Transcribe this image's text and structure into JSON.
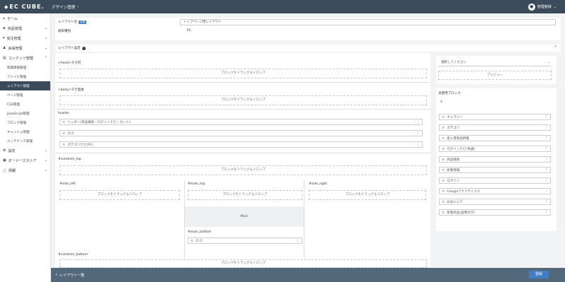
{
  "header": {
    "logo_mark": "◆",
    "logo_text": "EC CUBE.",
    "breadcrumb": "デザイン管理",
    "breadcrumb_icon": "chevron-right-icon",
    "user_name": "管理者様",
    "user_icon": "user-circle-icon"
  },
  "sidebar": {
    "items": [
      {
        "label": "ホーム",
        "icon": "home-icon"
      },
      {
        "label": "商品管理",
        "icon": "tag-icon"
      },
      {
        "label": "受注管理",
        "icon": "cart-icon"
      },
      {
        "label": "会員管理",
        "icon": "users-icon"
      },
      {
        "label": "コンテンツ管理",
        "icon": "document-icon"
      }
    ],
    "sub_items": [
      "新着情報管理",
      "ファイル管理",
      "レイアウト管理",
      "ページ管理",
      "CSS管理",
      "JavaScript管理",
      "ブロック管理",
      "キャッシュ管理",
      "メンテナンス管理"
    ],
    "bottom_items": [
      {
        "label": "設定",
        "icon": "gear-icon"
      },
      {
        "label": "オーナーズストア",
        "icon": "store-icon"
      },
      {
        "label": "情報",
        "icon": "info-icon"
      }
    ]
  },
  "settings": {
    "layout_name_label": "レイアウト名",
    "required_badge": "必須",
    "layout_name_value": "トップページ用レイアウト",
    "device_label": "端末種別",
    "device_value": "PC"
  },
  "layout_section": {
    "title": "レイアウト設定",
    "help_icon": "question-icon",
    "collapse_icon": "chevron-up-icon"
  },
  "areas": {
    "head_title": "<head>タグ内",
    "drop_text": "ブロックをドラッグ＆ドロップ",
    "body_prepend_title": "<body>タグ直後",
    "header_title": "header",
    "header_rows": [
      "ヘッダー(商品検索・ログインナビ・カート)",
      "ロゴ",
      "カテゴリナビ(PC)"
    ],
    "contents_top_title": "#contents_top",
    "side_left_title": "#side_left",
    "main_top_title": "#main_top",
    "main_label": "Main",
    "main_bottom_title": "#main_bottom",
    "main_bottom_rows": [
      "ロゴ"
    ],
    "side_right_title": "#side_right",
    "contents_bottom_title": "#contents_bottom"
  },
  "preview": {
    "select_placeholder": "選択してください",
    "preview_button": "プレビュー"
  },
  "unused_blocks": {
    "title": "未使用ブロック",
    "search_icon": "search-icon",
    "items": [
      "ギャラリー",
      "カテゴリ",
      "新入荷商品特集",
      "ログインナビ(共通)",
      "商品検索",
      "新着情報",
      "ログイン",
      "Googleアナリティクス",
      "お気に入り",
      "新着商品(画像付き)"
    ]
  },
  "footer": {
    "back_icon": "chevron-double-left-icon",
    "back_label": "レイアウト一覧",
    "register_label": "登録"
  }
}
